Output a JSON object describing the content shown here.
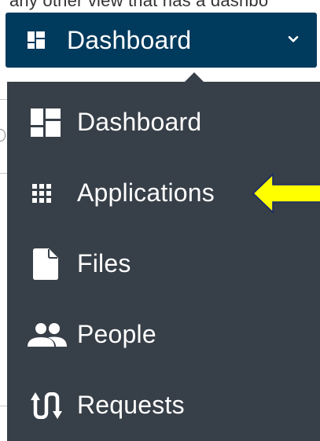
{
  "background": {
    "partial_text": "any other view that has a dashbo"
  },
  "trigger": {
    "label": "Dashboard",
    "icon": "dashboard-icon",
    "chevron": "chevron-down-icon",
    "bg_color": "#003a5c"
  },
  "menu": {
    "bg_color": "#373f48",
    "items": [
      {
        "label": "Dashboard",
        "icon": "dashboard-icon"
      },
      {
        "label": "Applications",
        "icon": "apps-grid-icon"
      },
      {
        "label": "Files",
        "icon": "file-icon"
      },
      {
        "label": "People",
        "icon": "people-icon"
      },
      {
        "label": "Requests",
        "icon": "requests-icon"
      }
    ]
  },
  "annotation": {
    "arrow_color": "#ffff00",
    "points_to": "Applications"
  }
}
